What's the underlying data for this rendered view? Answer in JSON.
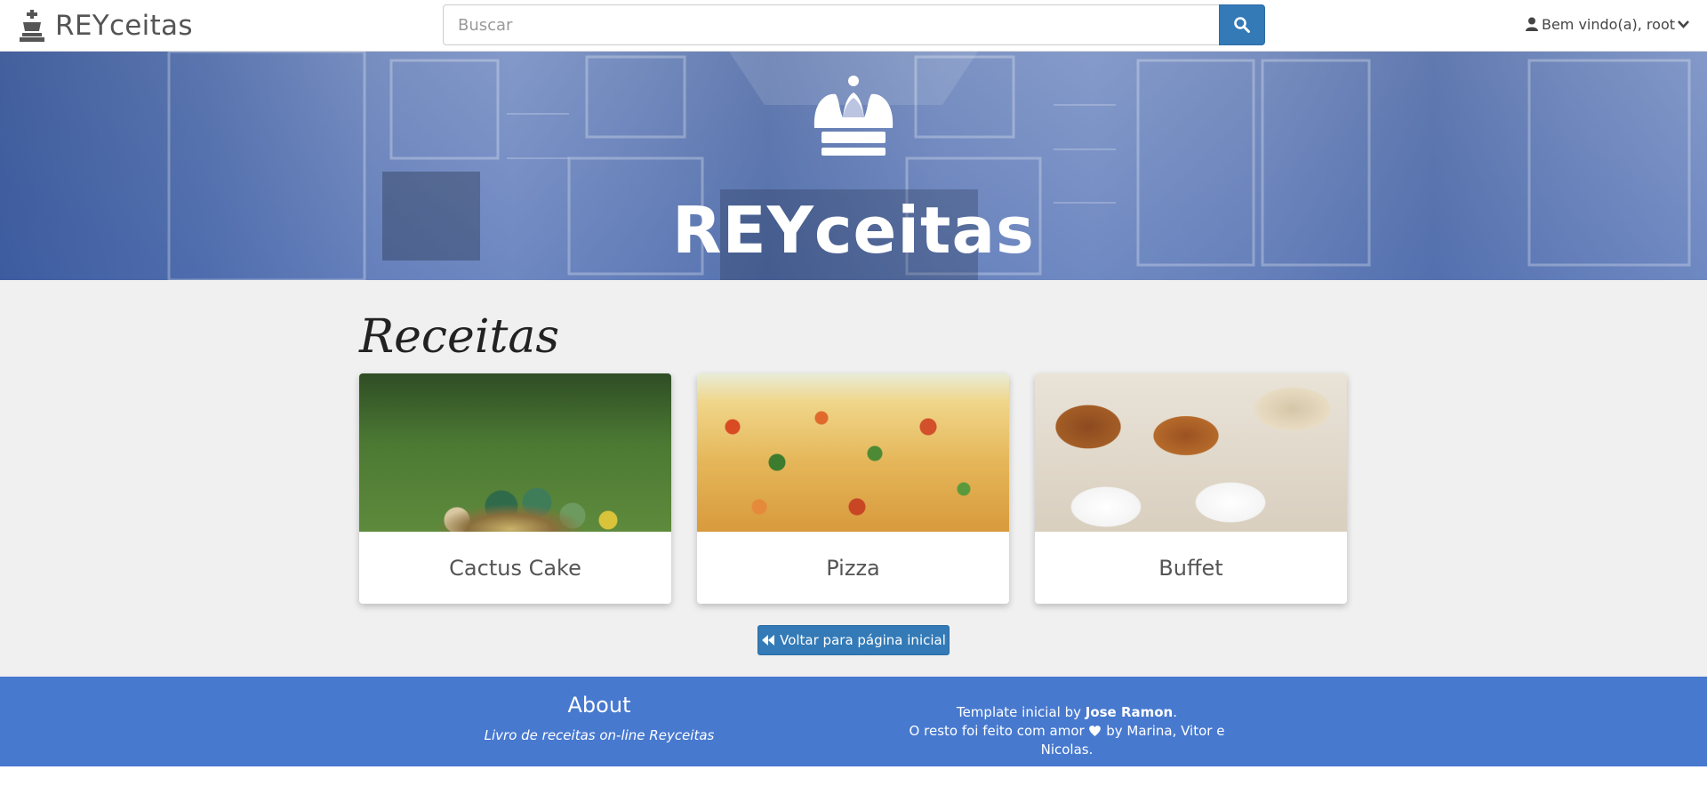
{
  "navbar": {
    "brand": "REYceitas",
    "brand_icon": "king-chess-piece-icon",
    "search": {
      "placeholder": "Buscar",
      "button_icon": "search-icon"
    },
    "user": {
      "greeting": "Bem vindo(a), root",
      "icon": "user-icon",
      "menu_icon": "chevron-down-icon"
    }
  },
  "hero": {
    "title": "REYceitas",
    "icon": "crown-icon"
  },
  "recipes": {
    "title": "Receitas",
    "items": [
      {
        "name": "Cactus Cake"
      },
      {
        "name": "Pizza"
      },
      {
        "name": "Buffet"
      }
    ],
    "back_button": {
      "label": "Voltar para página inicial",
      "icon": "fast-backward-icon"
    }
  },
  "footer": {
    "about_title": "About",
    "about_text": "Livro de receitas on-line Reyceitas",
    "credits_line1_prefix": "Template inicial by ",
    "credits_line1_author": "Jose Ramon",
    "credits_line1_suffix": ".",
    "credits_line2_prefix": "O resto foi feito com amor",
    "credits_line2_suffix": " by Marina, Vitor e Nicolas.",
    "heart_icon": "heart-icon"
  },
  "colors": {
    "primary": "#337ab7",
    "footer": "#4779cf",
    "hero_overlay": "#2850aa",
    "main_bg": "#f0f0f0"
  }
}
